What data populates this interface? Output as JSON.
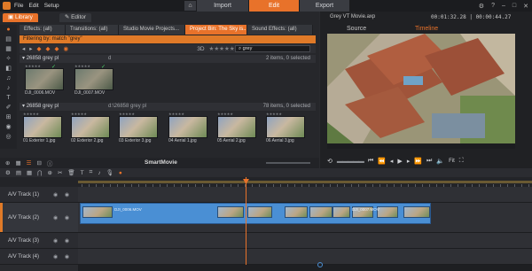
{
  "menu": [
    "File",
    "Edit",
    "Setup"
  ],
  "modes": [
    {
      "label": "Import",
      "active": false
    },
    {
      "label": "Edit",
      "active": true
    },
    {
      "label": "Export",
      "active": false
    }
  ],
  "colors": {
    "accent": "#e8722a",
    "clip": "#4a8fd4",
    "check": "#4ed26a"
  },
  "library": {
    "head_tabs": [
      {
        "label": "Library",
        "active": true
      },
      {
        "label": "Editor",
        "active": false
      }
    ],
    "source_tabs": [
      {
        "label": "Effects: (all)",
        "active": false
      },
      {
        "label": "Transitions: (all)",
        "active": false
      },
      {
        "label": "Studio Movie Projects...",
        "active": false
      },
      {
        "label": "Project Bin: The Sky is...",
        "active": true
      },
      {
        "label": "Sound Effects: (all)",
        "active": false
      }
    ],
    "filter": "Filtering by:  match \"grey\"",
    "view_mode": "3D",
    "search_value": "grey",
    "sections": [
      {
        "title": "26858 grey pl",
        "middle": "d",
        "count": "2 items, 0 selected",
        "items": [
          {
            "name": "DJI_0006.MOV",
            "checked": true
          },
          {
            "name": "DJI_0007.MOV",
            "checked": true
          }
        ]
      },
      {
        "title": "26858 grey pl",
        "middle": "d:\\26858 grey pl",
        "count": "78 items, 0 selected",
        "items": [
          {
            "name": "01 Exterior 1.jpg"
          },
          {
            "name": "02 Exterior 2.jpg"
          },
          {
            "name": "03 Exterior 3.jpg"
          },
          {
            "name": "04 Aerial 1.jpg"
          },
          {
            "name": "05 Aerial 2.jpg"
          },
          {
            "name": "06 Aerial 3.jpg"
          }
        ]
      }
    ],
    "bottom_label": "SmartMovie"
  },
  "preview": {
    "file": "Grey VT Movie.axp",
    "timecode": "00:01:32.28 | 00:00:44.27",
    "tabs": [
      {
        "label": "Source",
        "active": false
      },
      {
        "label": "Timeline",
        "active": true
      }
    ],
    "fit_label": "Fit"
  },
  "tracks": [
    {
      "name": "A/V Track (1)",
      "active": false
    },
    {
      "name": "A/V Track (2)",
      "active": true
    },
    {
      "name": "A/V Track (3)",
      "active": false
    },
    {
      "name": "A/V Track (4)",
      "active": false
    }
  ],
  "clips": {
    "main_name": "DJI_0006.MOV",
    "second_name": "DJI_0007.MOV"
  }
}
